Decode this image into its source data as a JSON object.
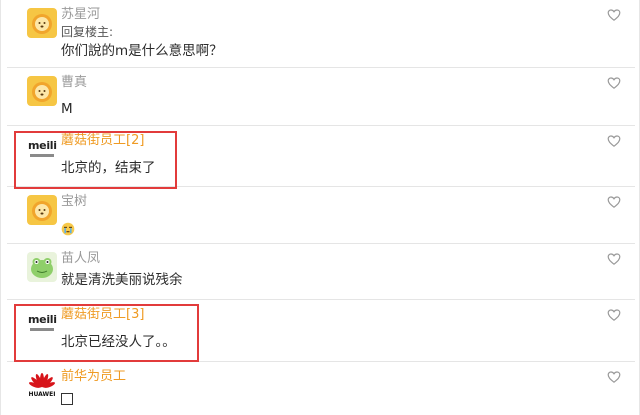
{
  "comments": [
    {
      "name": "苏星河",
      "reply_label": "回复楼主:",
      "text": "你们說的m是什么意思啊？",
      "avatar": "lion-icon"
    },
    {
      "name": "曹真",
      "text": "M",
      "avatar": "lion-icon"
    },
    {
      "name": "蘑菇街员工[2]",
      "text": "北京的，结束了",
      "avatar": "meili-logo",
      "avatar_text": "meili"
    },
    {
      "name": "宝树",
      "text": "",
      "emoji": "crying-face-icon",
      "avatar": "lion-icon"
    },
    {
      "name": "苗人凤",
      "text": "就是清洗美丽说残余",
      "avatar": "frog-icon"
    },
    {
      "name": "蘑菇街员工[3]",
      "text": "北京已经没人了。。",
      "avatar": "meili-logo",
      "avatar_text": "meili"
    },
    {
      "name": "前华为员工",
      "text": "",
      "symbol": "empty-square-icon",
      "avatar": "huawei-logo",
      "avatar_text": "HUAWEI"
    }
  ],
  "colors": {
    "name_gray": "#9a9a9a",
    "name_orange": "#ef9b24",
    "highlight_red": "#e23b3b"
  }
}
